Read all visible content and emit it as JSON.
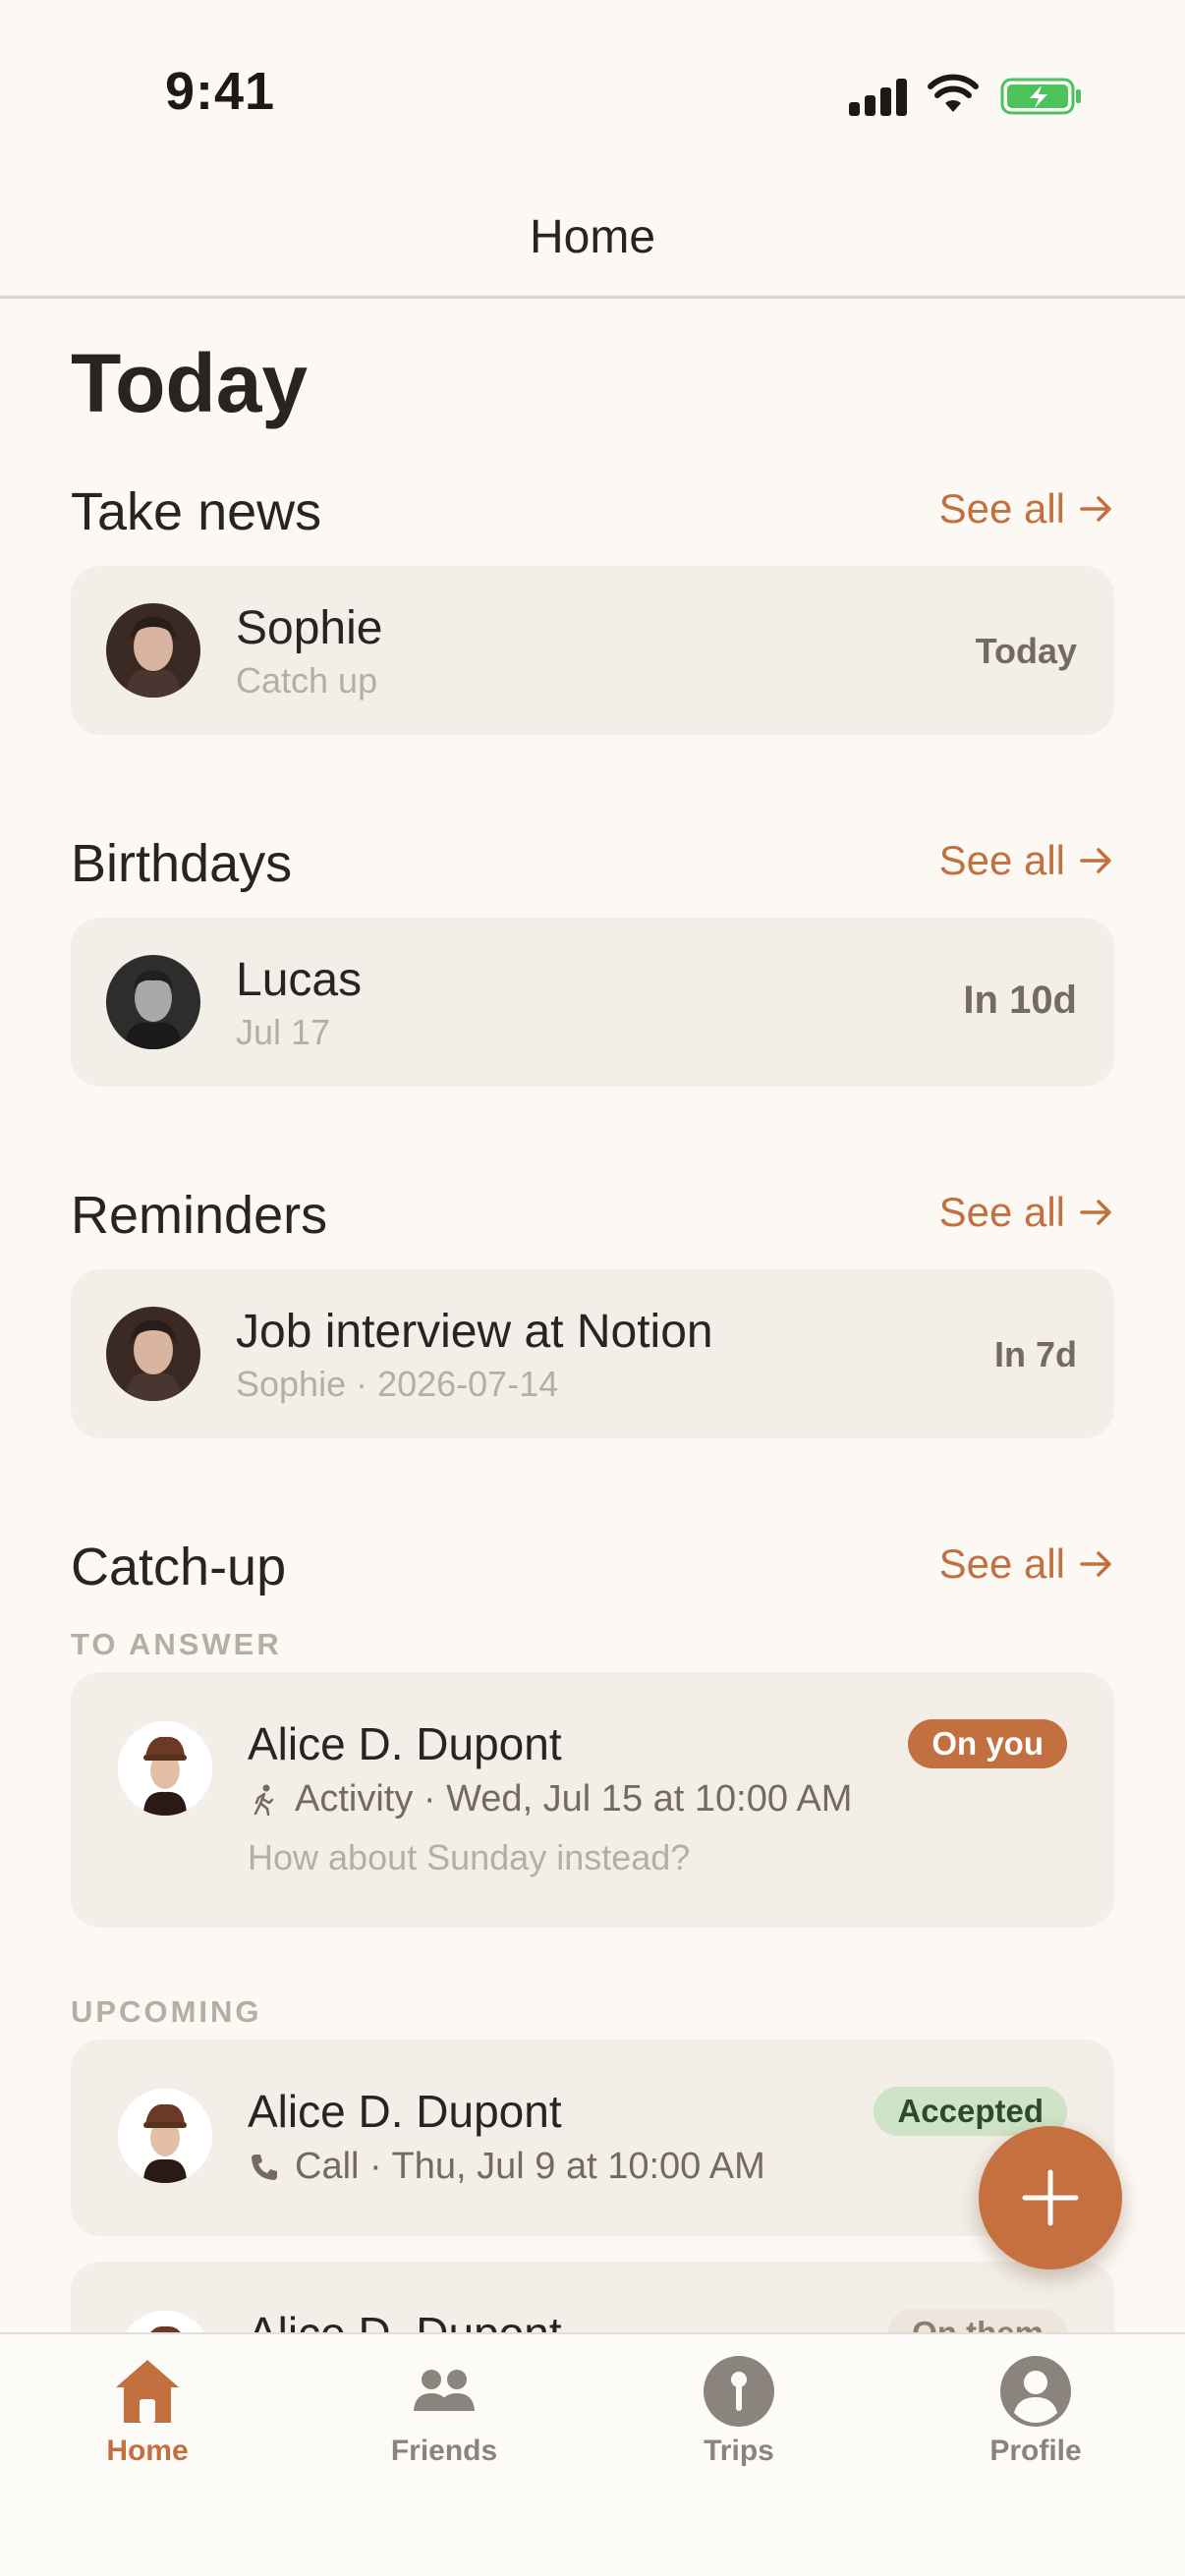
{
  "status_bar": {
    "time": "9:41"
  },
  "header": {
    "title": "Home"
  },
  "page": {
    "title": "Today"
  },
  "sections": {
    "take_news": {
      "title": "Take news",
      "see_all": "See all",
      "card": {
        "name": "Sophie",
        "subtitle": "Catch up",
        "right": "Today"
      }
    },
    "birthdays": {
      "title": "Birthdays",
      "see_all": "See all",
      "card": {
        "name": "Lucas",
        "subtitle": "Jul 17",
        "right": "In 10d"
      }
    },
    "reminders": {
      "title": "Reminders",
      "see_all": "See all",
      "card": {
        "name": "Job interview at Notion",
        "subtitle": "Sophie · 2026-07-14",
        "right": "In 7d"
      }
    },
    "catch_up": {
      "title": "Catch-up",
      "see_all": "See all",
      "to_answer_label": "TO ANSWER",
      "upcoming_label": "UPCOMING",
      "items": [
        {
          "name": "Alice D. Dupont",
          "icon": "walking-icon",
          "detail": "Activity · Wed, Jul 15 at 10:00 AM",
          "message": "How about Sunday instead?",
          "badge": "On you"
        },
        {
          "name": "Alice D. Dupont",
          "icon": "phone-icon",
          "detail": "Call · Thu, Jul 9 at 10:00 AM",
          "badge": "Accepted"
        },
        {
          "name": "Alice D. Dupont",
          "badge": "On them"
        }
      ]
    }
  },
  "tab_bar": {
    "tabs": [
      {
        "label": "Home",
        "icon": "home-icon",
        "active": true
      },
      {
        "label": "Friends",
        "icon": "friends-icon",
        "active": false
      },
      {
        "label": "Trips",
        "icon": "pin-icon",
        "active": false
      },
      {
        "label": "Profile",
        "icon": "person-icon",
        "active": false
      }
    ]
  },
  "colors": {
    "background": "#fcf9f5",
    "card": "#f3efe8",
    "accent": "#c2703f",
    "badge_accepted": "#cfe3c6",
    "tab_inactive": "#8a847d"
  }
}
